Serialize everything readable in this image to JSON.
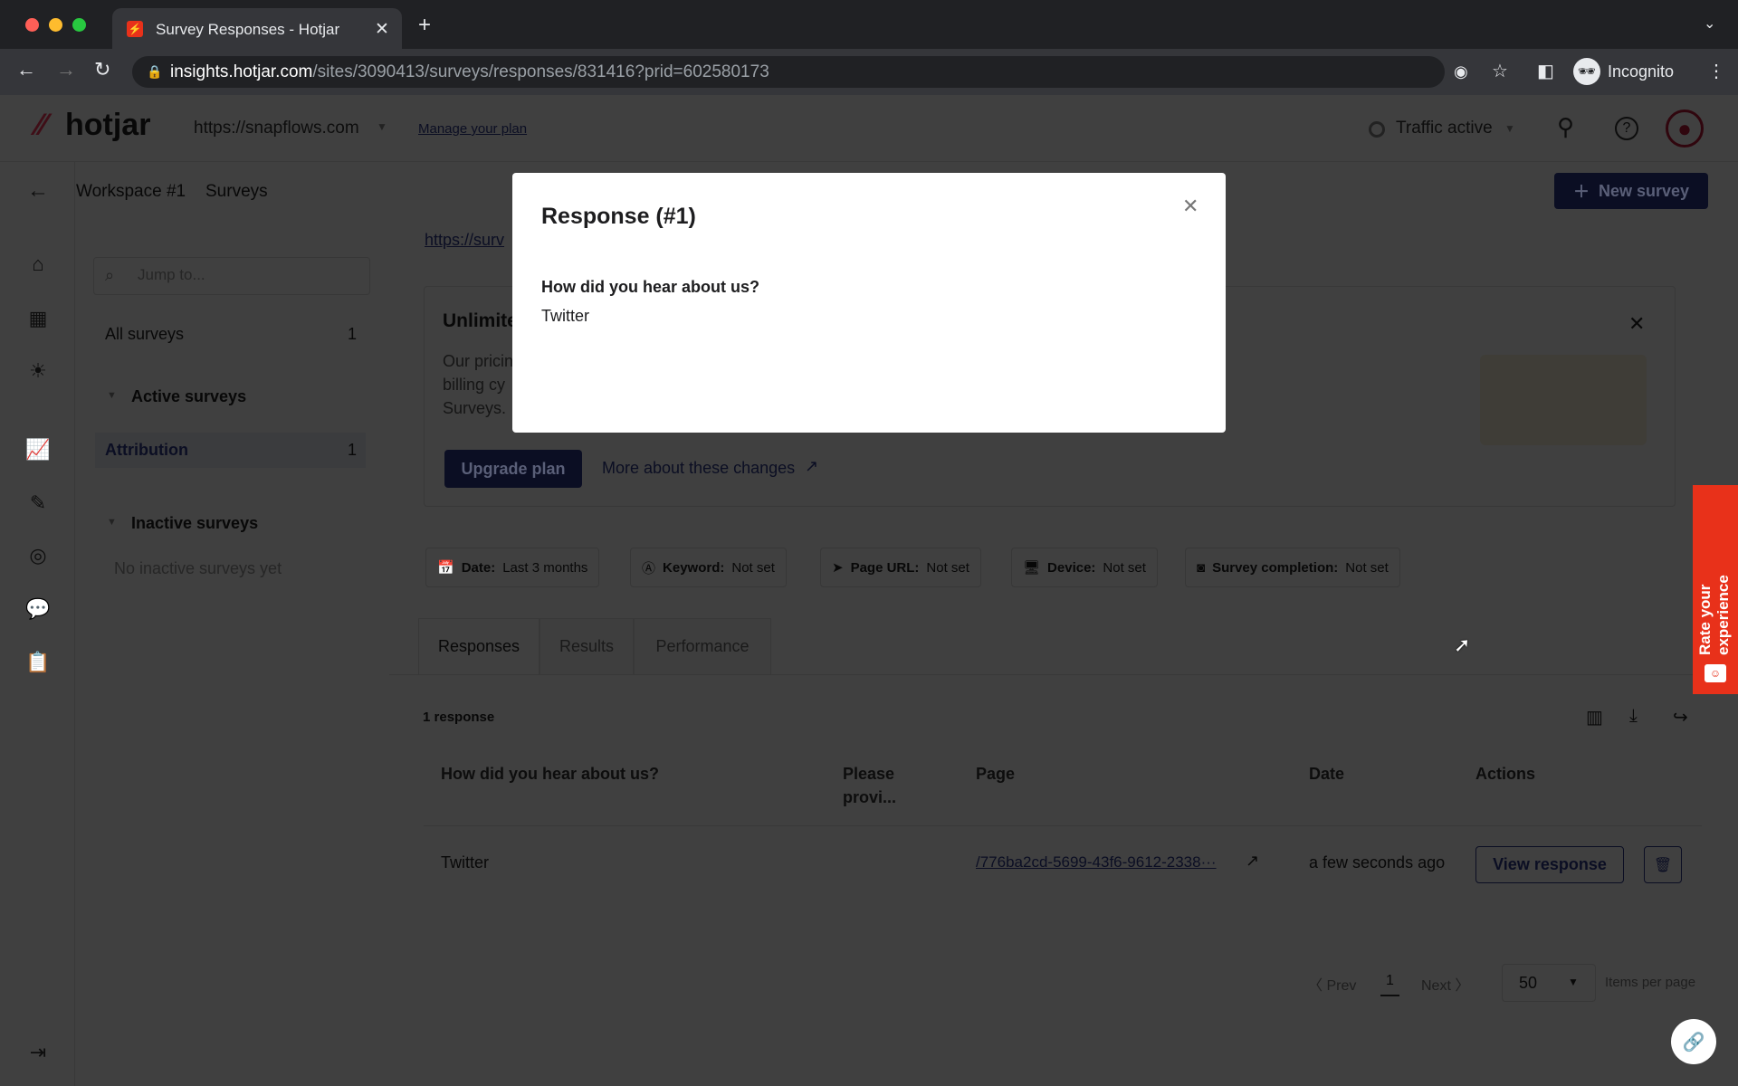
{
  "browser": {
    "tab_title": "Survey Responses - Hotjar",
    "url_host": "insights.hotjar.com",
    "url_path": "/sites/3090413/surveys/responses/831416?prid=602580173",
    "profile": "Incognito"
  },
  "header": {
    "logo": "hotjar",
    "site": "https://snapflows.com",
    "manage_plan": "Manage your plan",
    "traffic": "Traffic active"
  },
  "breadcrumb": {
    "workspace": "Workspace #1",
    "section": "Surveys"
  },
  "new_survey": "New survey",
  "sidebar": {
    "search_placeholder": "Jump to...",
    "all_surveys": "All surveys",
    "all_count": "1",
    "active_heading": "Active surveys",
    "active_items": [
      {
        "label": "Attribution",
        "count": "1"
      }
    ],
    "inactive_heading": "Inactive surveys",
    "inactive_empty": "No inactive surveys yet"
  },
  "survey_link": "https://surv",
  "banner": {
    "title": "Unlimite",
    "lines": [
      "Our pricin",
      "billing cy",
      "Surveys."
    ],
    "upgrade": "Upgrade plan",
    "more": "More about these changes"
  },
  "filters": [
    {
      "key": "Date:",
      "value": "Last 3 months",
      "icon": "calendar-icon"
    },
    {
      "key": "Keyword:",
      "value": "Not set",
      "icon": "keyword-icon"
    },
    {
      "key": "Page URL:",
      "value": "Not set",
      "icon": "location-arrow-icon"
    },
    {
      "key": "Device:",
      "value": "Not set",
      "icon": "monitor-icon"
    },
    {
      "key": "Survey completion:",
      "value": "Not set",
      "icon": "completion-icon"
    }
  ],
  "tabs": [
    "Responses",
    "Results",
    "Performance"
  ],
  "count": "1 response",
  "table": {
    "headers": [
      "How did you hear about us?",
      "Please provi...",
      "Page",
      "Date",
      "Actions"
    ],
    "rows": [
      {
        "answer": "Twitter",
        "other": "",
        "page": "/776ba2cd-5699-43f6-9612-2338···",
        "date": "a few seconds ago",
        "view": "View response"
      }
    ]
  },
  "pagination": {
    "prev": "Prev",
    "page": "1",
    "next": "Next",
    "per_page": "50",
    "per_page_label": "Items per page"
  },
  "modal": {
    "title": "Response (#1)",
    "question": "How did you hear about us?",
    "answer": "Twitter"
  },
  "feedback_tab": "Rate your experience",
  "colors": {
    "brand": "#fd3a5c",
    "primary": "#2d3a8c",
    "feedback": "#e8311a"
  }
}
